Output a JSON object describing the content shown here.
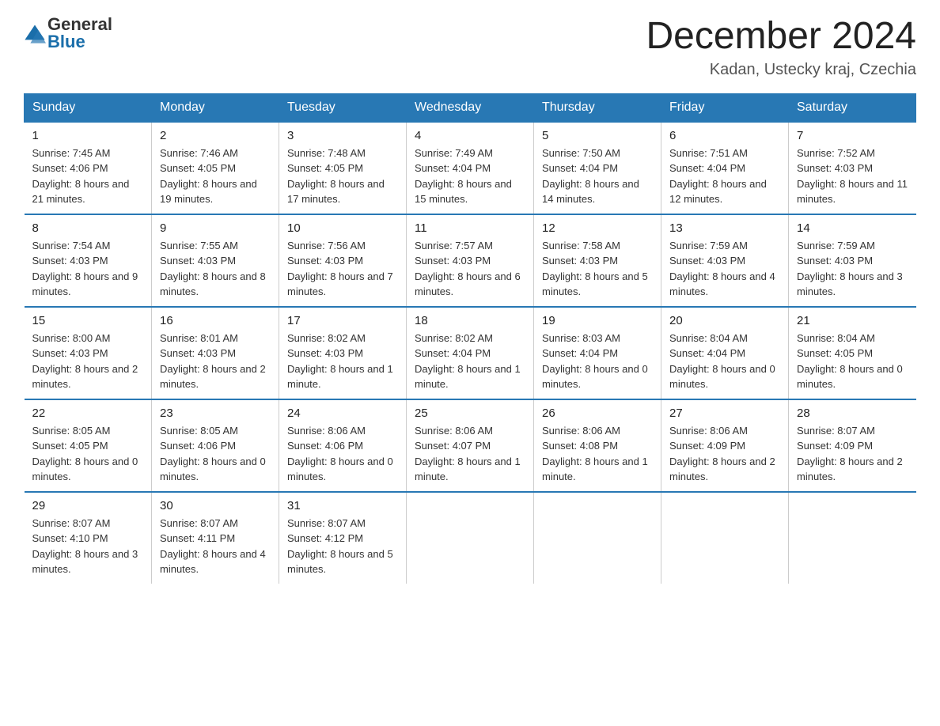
{
  "header": {
    "logo_general": "General",
    "logo_blue": "Blue",
    "title": "December 2024",
    "subtitle": "Kadan, Ustecky kraj, Czechia"
  },
  "days_of_week": [
    "Sunday",
    "Monday",
    "Tuesday",
    "Wednesday",
    "Thursday",
    "Friday",
    "Saturday"
  ],
  "weeks": [
    [
      {
        "date": "1",
        "sunrise": "7:45 AM",
        "sunset": "4:06 PM",
        "daylight": "8 hours and 21 minutes."
      },
      {
        "date": "2",
        "sunrise": "7:46 AM",
        "sunset": "4:05 PM",
        "daylight": "8 hours and 19 minutes."
      },
      {
        "date": "3",
        "sunrise": "7:48 AM",
        "sunset": "4:05 PM",
        "daylight": "8 hours and 17 minutes."
      },
      {
        "date": "4",
        "sunrise": "7:49 AM",
        "sunset": "4:04 PM",
        "daylight": "8 hours and 15 minutes."
      },
      {
        "date": "5",
        "sunrise": "7:50 AM",
        "sunset": "4:04 PM",
        "daylight": "8 hours and 14 minutes."
      },
      {
        "date": "6",
        "sunrise": "7:51 AM",
        "sunset": "4:04 PM",
        "daylight": "8 hours and 12 minutes."
      },
      {
        "date": "7",
        "sunrise": "7:52 AM",
        "sunset": "4:03 PM",
        "daylight": "8 hours and 11 minutes."
      }
    ],
    [
      {
        "date": "8",
        "sunrise": "7:54 AM",
        "sunset": "4:03 PM",
        "daylight": "8 hours and 9 minutes."
      },
      {
        "date": "9",
        "sunrise": "7:55 AM",
        "sunset": "4:03 PM",
        "daylight": "8 hours and 8 minutes."
      },
      {
        "date": "10",
        "sunrise": "7:56 AM",
        "sunset": "4:03 PM",
        "daylight": "8 hours and 7 minutes."
      },
      {
        "date": "11",
        "sunrise": "7:57 AM",
        "sunset": "4:03 PM",
        "daylight": "8 hours and 6 minutes."
      },
      {
        "date": "12",
        "sunrise": "7:58 AM",
        "sunset": "4:03 PM",
        "daylight": "8 hours and 5 minutes."
      },
      {
        "date": "13",
        "sunrise": "7:59 AM",
        "sunset": "4:03 PM",
        "daylight": "8 hours and 4 minutes."
      },
      {
        "date": "14",
        "sunrise": "7:59 AM",
        "sunset": "4:03 PM",
        "daylight": "8 hours and 3 minutes."
      }
    ],
    [
      {
        "date": "15",
        "sunrise": "8:00 AM",
        "sunset": "4:03 PM",
        "daylight": "8 hours and 2 minutes."
      },
      {
        "date": "16",
        "sunrise": "8:01 AM",
        "sunset": "4:03 PM",
        "daylight": "8 hours and 2 minutes."
      },
      {
        "date": "17",
        "sunrise": "8:02 AM",
        "sunset": "4:03 PM",
        "daylight": "8 hours and 1 minute."
      },
      {
        "date": "18",
        "sunrise": "8:02 AM",
        "sunset": "4:04 PM",
        "daylight": "8 hours and 1 minute."
      },
      {
        "date": "19",
        "sunrise": "8:03 AM",
        "sunset": "4:04 PM",
        "daylight": "8 hours and 0 minutes."
      },
      {
        "date": "20",
        "sunrise": "8:04 AM",
        "sunset": "4:04 PM",
        "daylight": "8 hours and 0 minutes."
      },
      {
        "date": "21",
        "sunrise": "8:04 AM",
        "sunset": "4:05 PM",
        "daylight": "8 hours and 0 minutes."
      }
    ],
    [
      {
        "date": "22",
        "sunrise": "8:05 AM",
        "sunset": "4:05 PM",
        "daylight": "8 hours and 0 minutes."
      },
      {
        "date": "23",
        "sunrise": "8:05 AM",
        "sunset": "4:06 PM",
        "daylight": "8 hours and 0 minutes."
      },
      {
        "date": "24",
        "sunrise": "8:06 AM",
        "sunset": "4:06 PM",
        "daylight": "8 hours and 0 minutes."
      },
      {
        "date": "25",
        "sunrise": "8:06 AM",
        "sunset": "4:07 PM",
        "daylight": "8 hours and 1 minute."
      },
      {
        "date": "26",
        "sunrise": "8:06 AM",
        "sunset": "4:08 PM",
        "daylight": "8 hours and 1 minute."
      },
      {
        "date": "27",
        "sunrise": "8:06 AM",
        "sunset": "4:09 PM",
        "daylight": "8 hours and 2 minutes."
      },
      {
        "date": "28",
        "sunrise": "8:07 AM",
        "sunset": "4:09 PM",
        "daylight": "8 hours and 2 minutes."
      }
    ],
    [
      {
        "date": "29",
        "sunrise": "8:07 AM",
        "sunset": "4:10 PM",
        "daylight": "8 hours and 3 minutes."
      },
      {
        "date": "30",
        "sunrise": "8:07 AM",
        "sunset": "4:11 PM",
        "daylight": "8 hours and 4 minutes."
      },
      {
        "date": "31",
        "sunrise": "8:07 AM",
        "sunset": "4:12 PM",
        "daylight": "8 hours and 5 minutes."
      },
      null,
      null,
      null,
      null
    ]
  ]
}
